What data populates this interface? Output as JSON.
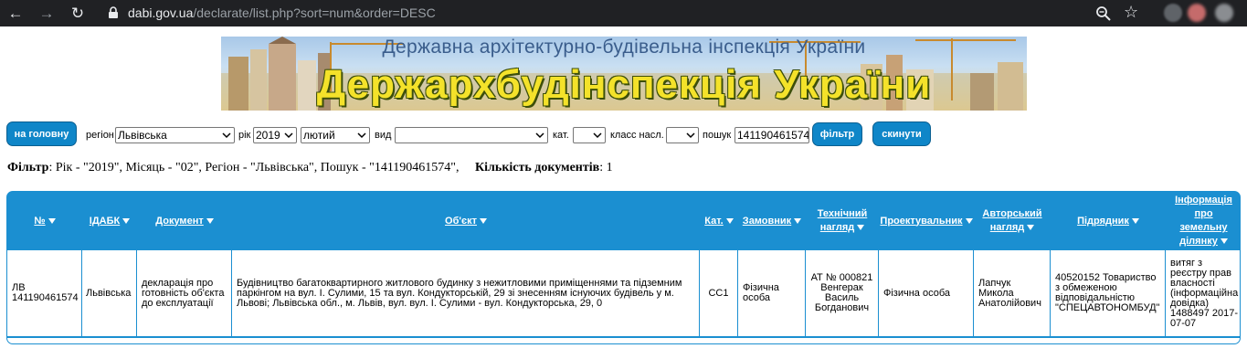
{
  "browser": {
    "url_host": "dabi.gov.ua",
    "url_path": "/declarate/list.php?sort=num&order=DESC"
  },
  "banner": {
    "subtitle": "Державна архітектурно-будівельна інспекція України",
    "title": "Держархбудінспекція України"
  },
  "filters": {
    "home_button": "на головну",
    "region_label": "регіон",
    "region_value": "Львівська",
    "year_label": "рік",
    "year_value": "2019",
    "month_value": "лютий",
    "type_label": "вид",
    "type_value": "",
    "cat_label": "кат.",
    "cat_value": "",
    "class_label": "класс насл.",
    "class_value": "",
    "search_label": "пошук",
    "search_value": "141190461574",
    "filter_button": "фільтр",
    "reset_button": "скинути"
  },
  "summary": {
    "filter_label": "Фільтр",
    "filter_text": ": Рік - \"2019\", Місяць - \"02\", Регіон - \"Львівська\", Пошук - \"141190461574\",",
    "count_label": "Кількість документів",
    "count_value": ": 1"
  },
  "table": {
    "headers": [
      "№",
      "ІДАБК",
      "Документ",
      "Об'єкт",
      "Кат.",
      "Замовник",
      "Технічний нагляд",
      "Проектувальник",
      "Авторський нагляд",
      "Підрядник",
      "Інформація про земельну ділянку"
    ],
    "rows": [
      [
        "ЛВ 141190461574",
        "Львівська",
        "декларація про готовність об'єкта до експлуатації",
        "Будівництво багатоквартирного житлового будинку з нежитловими приміщеннями та підземним паркінгом на вул. І. Сулими, 15 та вул. Кондукторській, 29 зі знесенням існуючих будівель у м. Львові; Львівська обл., м. Львів, вул. вул. І. Сулими - вул. Кондукторська, 29, 0",
        "СС1",
        "Фізична особа",
        "АТ № 000821 Венгерак Василь Богданович",
        "Фізична особа",
        "Лапчук Микола Анатолійович",
        "40520152 Товариство з обмеженою відповідальністю \"СПЕЦАВТОНОМБУД\"",
        "витяг з реєстру прав власності (інформаційна довідка) 1488497 2017-07-07"
      ]
    ]
  },
  "colors": {
    "accent": "#1b8fd1",
    "button": "#0f86c8",
    "chrome_bg": "#202124"
  }
}
